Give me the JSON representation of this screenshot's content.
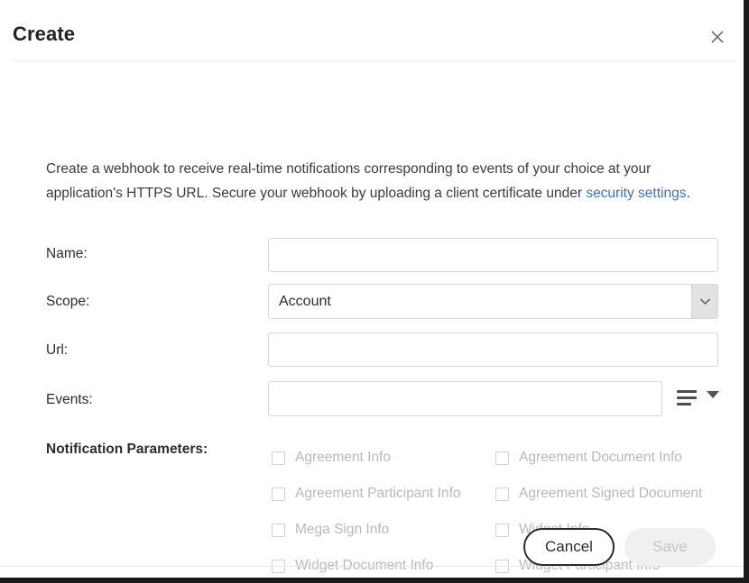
{
  "dialog": {
    "title": "Create",
    "close_icon": "close-icon"
  },
  "description": {
    "text_before_link": "Create a webhook to receive real-time notifications corresponding to events of your choice at your application's HTTPS URL. Secure your webhook by uploading a client certificate under ",
    "link_text": "security settings",
    "text_after_link": "."
  },
  "form": {
    "name": {
      "label": "Name:",
      "value": "",
      "placeholder": ""
    },
    "scope": {
      "label": "Scope:",
      "value": "Account",
      "options": [
        "Account"
      ],
      "arrow_icon": "chevron-down-icon"
    },
    "url": {
      "label": "Url:",
      "value": "",
      "placeholder": ""
    },
    "events": {
      "label": "Events:",
      "value": "",
      "placeholder": "",
      "menu_icon": "list-menu-icon",
      "caret_icon": "caret-down-icon"
    }
  },
  "notification_parameters": {
    "label": "Notification Parameters:",
    "rows": [
      [
        {
          "label": "Agreement Info",
          "checked": false,
          "disabled": true
        },
        {
          "label": "Agreement Document Info",
          "checked": false,
          "disabled": true
        }
      ],
      [
        {
          "label": "Agreement Participant Info",
          "checked": false,
          "disabled": true
        },
        {
          "label": "Agreement Signed Document",
          "checked": false,
          "disabled": true
        }
      ],
      [
        {
          "label": "Mega Sign Info",
          "checked": false,
          "disabled": true
        },
        {
          "label": "Widget Info",
          "checked": false,
          "disabled": true
        }
      ],
      [
        {
          "label": "Widget Document Info",
          "checked": false,
          "disabled": true
        },
        {
          "label": "Widget Participant Info",
          "checked": false,
          "disabled": true
        }
      ]
    ]
  },
  "footer": {
    "cancel_label": "Cancel",
    "save_label": "Save",
    "save_disabled": true
  },
  "colors": {
    "link": "#3b73c4",
    "title_text": "#222222",
    "body_text": "#3b3b3b",
    "disabled_text": "#b9b9b9",
    "border": "#d8d8d8",
    "button_outline": "#2c2c2c",
    "save_disabled_bg": "#f0f0f0"
  }
}
